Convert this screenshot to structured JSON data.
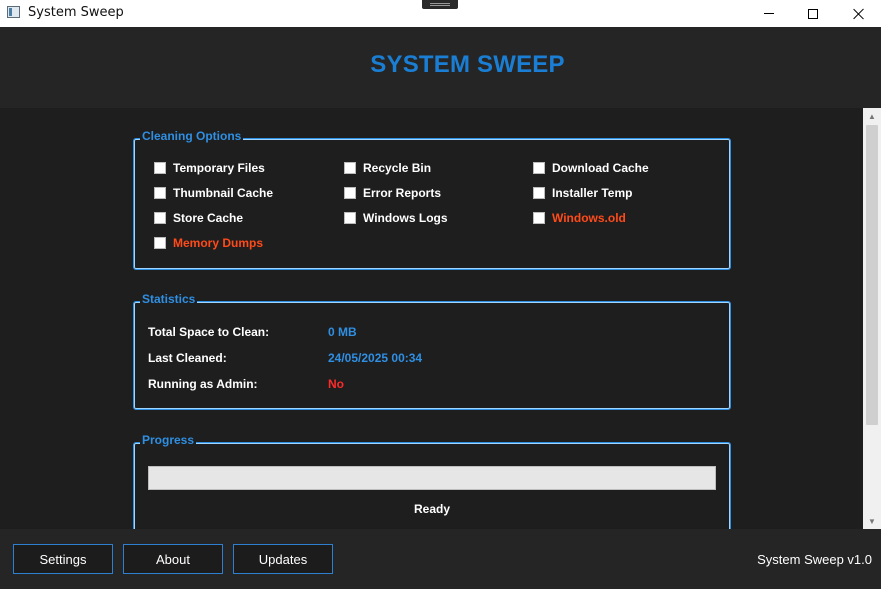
{
  "window": {
    "title": "System Sweep",
    "icon": "app-icon",
    "controls": [
      "minimize",
      "maximize",
      "close"
    ]
  },
  "header": {
    "title": "SYSTEM SWEEP",
    "color": "#1a7fd4"
  },
  "cleaning_options": {
    "title": "Cleaning Options",
    "items": [
      {
        "label": "Temporary Files",
        "checked": false,
        "warning": false
      },
      {
        "label": "Recycle Bin",
        "checked": false,
        "warning": false
      },
      {
        "label": "Download Cache",
        "checked": false,
        "warning": false
      },
      {
        "label": "Thumbnail Cache",
        "checked": false,
        "warning": false
      },
      {
        "label": "Error Reports",
        "checked": false,
        "warning": false
      },
      {
        "label": "Installer Temp",
        "checked": false,
        "warning": false
      },
      {
        "label": "Store Cache",
        "checked": false,
        "warning": false
      },
      {
        "label": "Windows Logs",
        "checked": false,
        "warning": false
      },
      {
        "label": "Windows.old",
        "checked": false,
        "warning": true
      },
      {
        "label": "Memory Dumps",
        "checked": false,
        "warning": true
      }
    ]
  },
  "statistics": {
    "title": "Statistics",
    "rows": [
      {
        "label": "Total Space to Clean:",
        "value": "0 MB"
      },
      {
        "label": "Last Cleaned:",
        "value": "24/05/2025 00:34"
      },
      {
        "label": "Running as Admin:",
        "value": "No"
      }
    ]
  },
  "progress": {
    "title": "Progress",
    "percent": 0,
    "status": "Ready"
  },
  "footer": {
    "buttons": {
      "settings": "Settings",
      "about": "About",
      "updates": "Updates"
    },
    "version": "System Sweep v1.0"
  },
  "colors": {
    "accent": "#2f8fe3",
    "warning": "#ff4a1a",
    "error": "#ff2a2a",
    "background": "#1e1e1e"
  }
}
